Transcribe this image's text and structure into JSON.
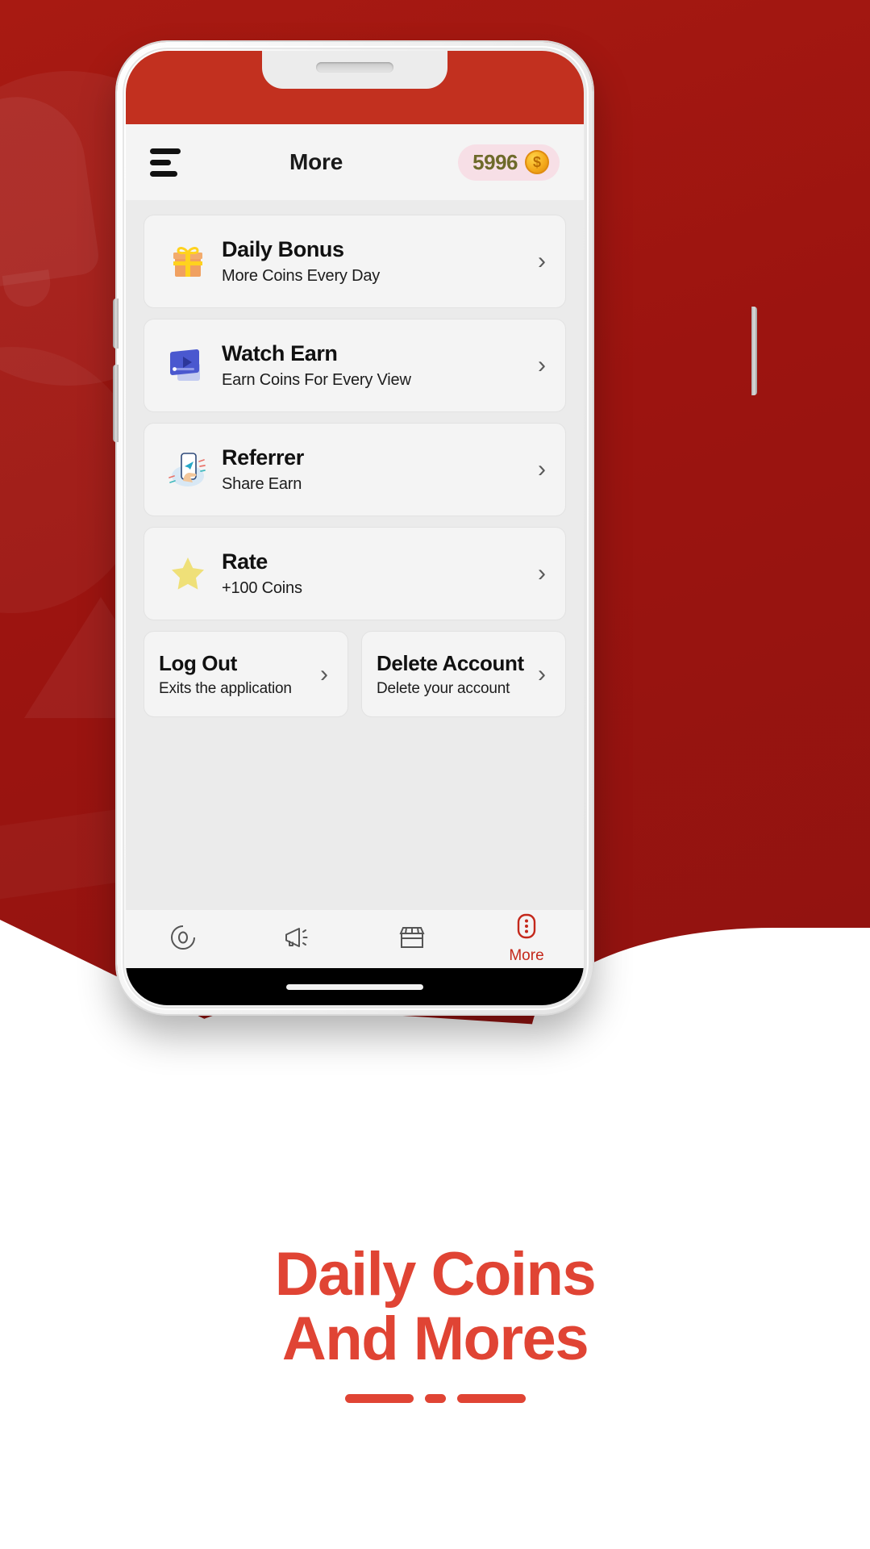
{
  "theme": {
    "brand_red": "#9e1510",
    "accent_red": "#e04434",
    "status_bar_red": "#c2301f",
    "coin_pill_bg": "#f7dfe6",
    "coin_text": "#6e6a2a",
    "screen_bg": "#ebebeb",
    "card_bg": "#f4f4f4"
  },
  "appbar": {
    "menu_icon": "hamburger-icon",
    "title": "More",
    "coin_balance": "5996",
    "coin_icon": "coin-icon",
    "coin_symbol": "$"
  },
  "menu_cards": [
    {
      "icon": "gift-icon",
      "title": "Daily Bonus",
      "subtitle": "More Coins Every Day",
      "chevron": "›"
    },
    {
      "icon": "video-player-icon",
      "title": "Watch Earn",
      "subtitle": "Earn Coins For Every View",
      "chevron": "›"
    },
    {
      "icon": "hand-phone-share-icon",
      "title": "Referrer",
      "subtitle": "Share Earn",
      "chevron": "›"
    },
    {
      "icon": "star-icon",
      "title": "Rate",
      "subtitle": "+100 Coins",
      "chevron": "›"
    }
  ],
  "account_actions": [
    {
      "title": "Log Out",
      "subtitle": "Exits the application",
      "chevron": "›"
    },
    {
      "title": "Delete Account",
      "subtitle": "Delete your account",
      "chevron": "›"
    }
  ],
  "bottom_nav": [
    {
      "icon": "spiral-disc-icon",
      "label": "",
      "active": false
    },
    {
      "icon": "megaphone-icon",
      "label": "",
      "active": false
    },
    {
      "icon": "store-icon",
      "label": "",
      "active": false
    },
    {
      "icon": "more-dots-icon",
      "label": "More",
      "active": true
    }
  ],
  "caption": {
    "line1": "Daily Coins",
    "line2": "And Mores"
  }
}
